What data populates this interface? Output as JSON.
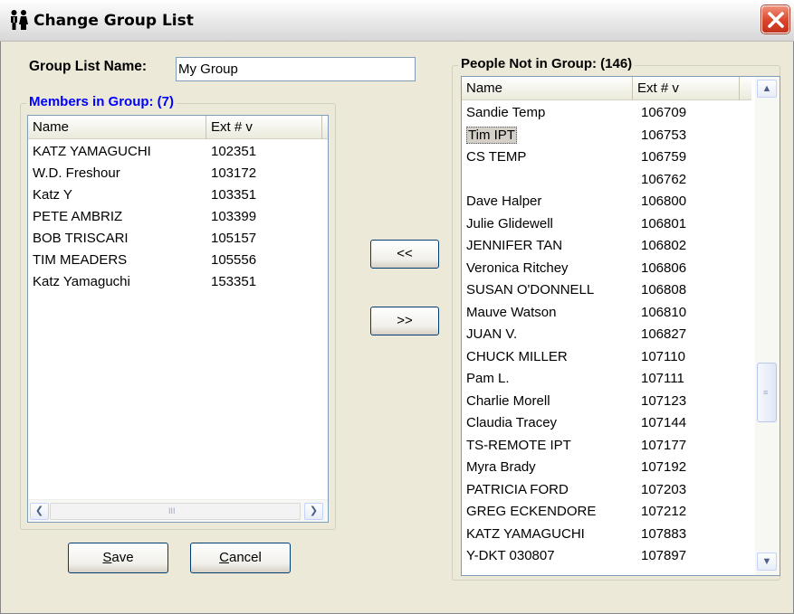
{
  "window": {
    "title": "Change Group List",
    "icon": "people-icon",
    "close_icon": "close-icon"
  },
  "group_name": {
    "label": "Group List Name:",
    "value": "My Group"
  },
  "members": {
    "legend": "Members in Group: (7)",
    "legend_color": "#0000ff",
    "columns": [
      "Name",
      "Ext #  v"
    ],
    "rows": [
      {
        "name": "KATZ YAMAGUCHI",
        "ext": "102351"
      },
      {
        "name": "W.D. Freshour",
        "ext": "103172"
      },
      {
        "name": "Katz Y",
        "ext": "103351"
      },
      {
        "name": "PETE  AMBRIZ",
        "ext": "103399"
      },
      {
        "name": "BOB TRISCARI",
        "ext": "105157"
      },
      {
        "name": "TIM MEADERS",
        "ext": "105556"
      },
      {
        "name": "Katz Yamaguchi",
        "ext": "153351"
      }
    ],
    "scroll_grip": "III"
  },
  "buttons": {
    "add": "<<",
    "remove": ">>",
    "save_hotkey": "S",
    "save_rest": "ave",
    "cancel_hotkey": "C",
    "cancel_rest": "ancel"
  },
  "people": {
    "legend": "People Not in Group: (146)",
    "columns": [
      "Name",
      "Ext #  v"
    ],
    "selected_index": 1,
    "rows": [
      {
        "name": "Sandie Temp",
        "ext": "106709"
      },
      {
        "name": "Tim IPT",
        "ext": "106753"
      },
      {
        "name": "CS TEMP",
        "ext": "106759"
      },
      {
        "name": "",
        "ext": "106762"
      },
      {
        "name": "Dave Halper",
        "ext": "106800"
      },
      {
        "name": "Julie Glidewell",
        "ext": "106801"
      },
      {
        "name": "JENNIFER TAN",
        "ext": "106802"
      },
      {
        "name": "Veronica Ritchey",
        "ext": "106806"
      },
      {
        "name": "SUSAN O'DONNELL",
        "ext": "106808"
      },
      {
        "name": "Mauve Watson",
        "ext": "106810"
      },
      {
        "name": "JUAN V.",
        "ext": "106827"
      },
      {
        "name": "CHUCK MILLER",
        "ext": "107110"
      },
      {
        "name": "Pam L.",
        "ext": "107111"
      },
      {
        "name": "Charlie Morell",
        "ext": "107123"
      },
      {
        "name": "Claudia Tracey",
        "ext": "107144"
      },
      {
        "name": "TS-REMOTE IPT",
        "ext": "107177"
      },
      {
        "name": "Myra Brady",
        "ext": "107192"
      },
      {
        "name": "PATRICIA FORD",
        "ext": "107203"
      },
      {
        "name": "GREG ECKENDORE",
        "ext": "107212"
      },
      {
        "name": "KATZ  YAMAGUCHI",
        "ext": "107883"
      },
      {
        "name": "Y-DKT 030807",
        "ext": "107897"
      }
    ]
  }
}
